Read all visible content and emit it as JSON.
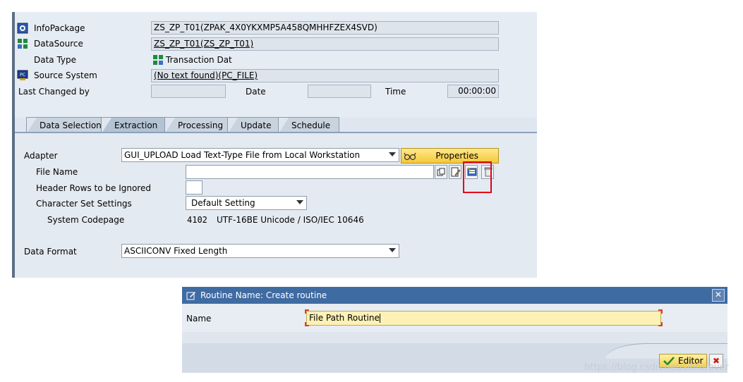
{
  "header": {
    "infopackage": {
      "label": "InfoPackage",
      "value": "ZS_ZP_T01(ZPAK_4X0YKXMP5A458QMHHFZEX4SVD)"
    },
    "datasource": {
      "label": "DataSource",
      "value": "ZS_ZP_T01(ZS_ZP_T01)"
    },
    "data_type": {
      "label": "Data Type",
      "value": "Transaction Dat"
    },
    "source_system": {
      "label": "Source System",
      "value": "(No text found)(PC_FILE)"
    },
    "last_changed_by": {
      "label": "Last Changed by",
      "value": ""
    },
    "date": {
      "label": "Date",
      "value": ""
    },
    "time": {
      "label": "Time",
      "value": "00:00:00"
    }
  },
  "tabs": [
    {
      "label": "Data Selection"
    },
    {
      "label": "Extraction"
    },
    {
      "label": "Processing"
    },
    {
      "label": "Update"
    },
    {
      "label": "Schedule"
    }
  ],
  "active_tab": "Extraction",
  "extraction": {
    "adapter": {
      "label": "Adapter",
      "value": "GUI_UPLOAD Load Text-Type File from Local Workstation"
    },
    "properties_label": "Properties",
    "file_name": {
      "label": "File Name",
      "value": ""
    },
    "header_rows": {
      "label": "Header Rows to be Ignored",
      "value": ""
    },
    "charset": {
      "label": "Character Set Settings",
      "value": "Default Setting"
    },
    "system_codepage": {
      "label": "System Codepage",
      "code": "4102",
      "value": "UTF-16BE Unicode / ISO/IEC 10646"
    },
    "data_format": {
      "label": "Data Format",
      "value": "ASCIICONV Fixed Length"
    }
  },
  "dialog": {
    "title": "Routine Name: Create routine",
    "close_label": "✕",
    "name_label": "Name",
    "name_value": "File Path Routine",
    "editor_label": "Editor",
    "cancel_label": "✖"
  },
  "watermark": "https://blog.csdn.net/sitiforever",
  "colors": {
    "highlight": "#e3001b",
    "dialog_title_bg": "#3f6ba3",
    "button_yellow": "#f5c83a"
  }
}
